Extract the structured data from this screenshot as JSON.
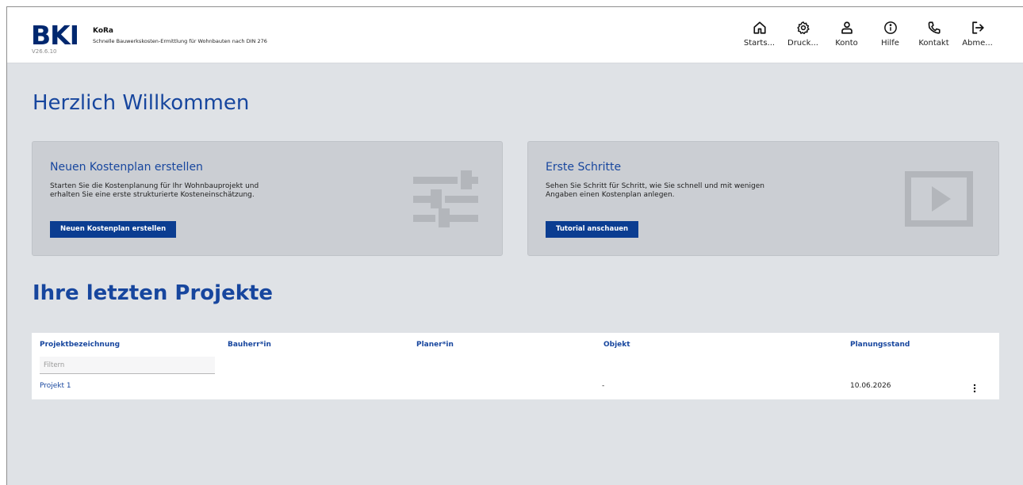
{
  "header": {
    "logo": "BKI",
    "version": "V26.6.10",
    "app_name": "KoRa",
    "app_subtitle": "Schnelle Bauwerkskosten-Ermittlung für Wohnbauten nach DIN 276"
  },
  "nav": [
    {
      "label": "Starts...",
      "icon": "home-icon"
    },
    {
      "label": "Druck...",
      "icon": "gear-icon"
    },
    {
      "label": "Konto",
      "icon": "user-icon"
    },
    {
      "label": "Hilfe",
      "icon": "info-icon"
    },
    {
      "label": "Kontakt",
      "icon": "phone-icon"
    },
    {
      "label": "Abme...",
      "icon": "logout-icon"
    }
  ],
  "welcome": "Herzlich Willkommen",
  "cards": {
    "new_plan": {
      "title": "Neuen Kostenplan erstellen",
      "text": "Starten Sie die Kostenplanung für Ihr Wohnbauprojekt und erhalten Sie eine erste strukturierte Kosteneinschätzung.",
      "button": "Neuen Kostenplan erstellen",
      "icon": "sliders-icon"
    },
    "first_steps": {
      "title": "Erste Schritte",
      "text": "Sehen Sie Schritt für Schritt, wie Sie schnell und mit wenigen Angaben einen Kostenplan anlegen.",
      "button": "Tutorial anschauen",
      "icon": "video-play-icon"
    }
  },
  "recent": {
    "title": "Ihre letzten Projekte",
    "columns": [
      "Projektbezeichnung",
      "Bauherr*in",
      "Planer*in",
      "Objekt",
      "Planungsstand"
    ],
    "filter_placeholder": "Filtern",
    "rows": [
      {
        "name": "Projekt 1",
        "bauherr": "",
        "planer": "",
        "objekt": "-",
        "planungsstand": "10.06.2026"
      }
    ]
  },
  "colors": {
    "brand": "#00286f",
    "accent_text": "#17469e",
    "button": "#0b3d91",
    "background": "#dfe2e6",
    "card": "#cbced3"
  }
}
